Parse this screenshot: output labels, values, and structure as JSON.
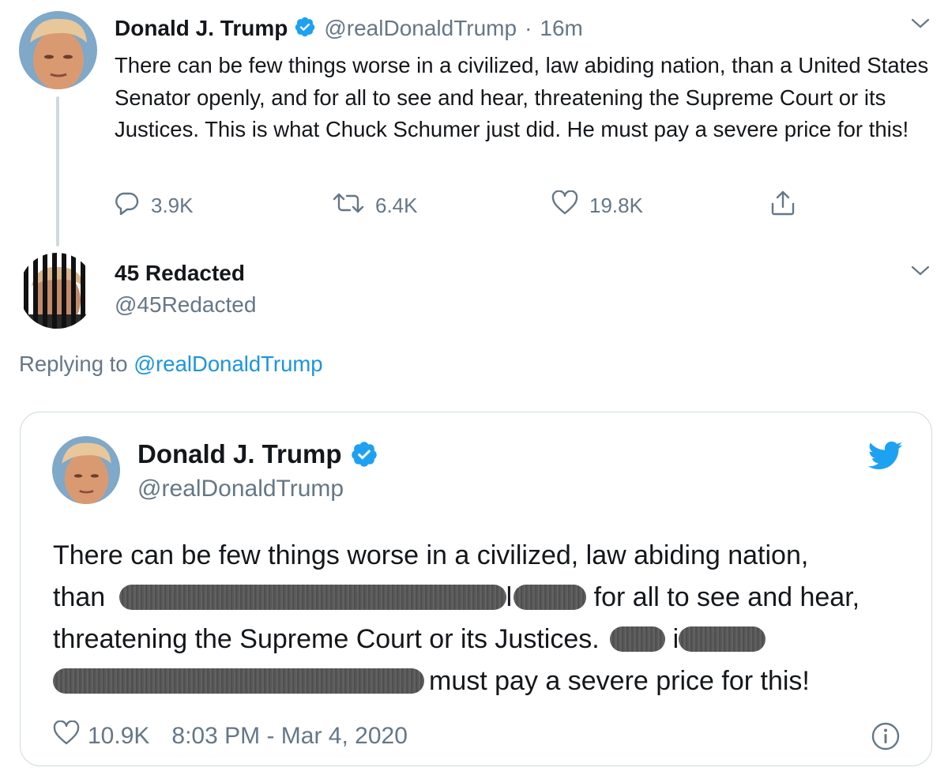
{
  "tweet": {
    "author_name": "Donald J. Trump",
    "author_handle": "@realDonaldTrump",
    "separator": "·",
    "time": "16m",
    "text": "There can be few things worse in a civilized, law abiding nation, than a United States Senator openly, and for all to see and hear, threatening the Supreme Court or its Justices. This is what Chuck Schumer just did. He must pay a severe price for this!",
    "actions": {
      "reply_count": "3.9K",
      "retweet_count": "6.4K",
      "like_count": "19.8K"
    },
    "icons": {
      "verified": "verified-badge-icon",
      "more": "chevron-down-icon",
      "reply": "reply-icon",
      "retweet": "retweet-icon",
      "like": "heart-icon",
      "share": "share-icon"
    }
  },
  "reply": {
    "author_name": "45 Redacted",
    "author_handle": "@45Redacted",
    "replying_prefix": "Replying to",
    "replying_mention": "@realDonaldTrump"
  },
  "embed": {
    "author_name": "Donald J. Trump",
    "author_handle": "@realDonaldTrump",
    "text_line1": "There can be few things worse in a civilized, law abiding nation,",
    "text_line2_a": "than",
    "text_line2_b": "l",
    "text_line2_c": "for all to see and hear,",
    "text_line3_a": "threatening the Supreme Court or its Justices.",
    "text_line3_b": "i",
    "text_line4": "must pay a severe price for this!",
    "like_count": "10.9K",
    "timestamp": "8:03 PM - Mar 4, 2020"
  },
  "colors": {
    "text": "#14171a",
    "muted": "#657786",
    "link": "#1b95e0",
    "twitter_blue": "#1da1f2",
    "border": "#cfd9de",
    "redaction": "#555555"
  }
}
